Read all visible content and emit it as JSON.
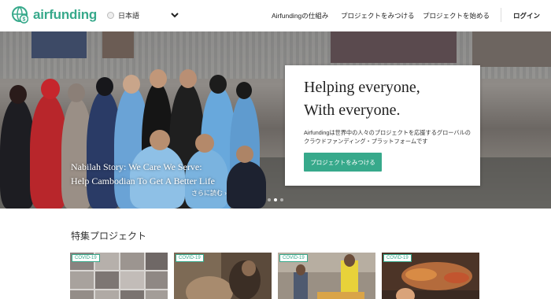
{
  "header": {
    "logo_text": "airfunding",
    "language": "日本語",
    "nav": [
      "Airfundingの仕組み",
      "プロジェクトをみつける",
      "プロジェクトを始める"
    ],
    "login": "ログイン"
  },
  "hero": {
    "caption_line1": "Nabilah Story: We Care We Serve:",
    "caption_line2": "Help Cambodian To Get A Better Life",
    "more_link": "さらに読む ›",
    "card": {
      "title_line1": "Helping everyone,",
      "title_line2": "With everyone.",
      "description": "Airfundingは世界中の人々のプロジェクトを応援するグローバルのクラウドファンディング・プラットフォームです",
      "button": "プロジェクトをみつける"
    }
  },
  "featured": {
    "title": "特集プロジェクト",
    "projects": [
      {
        "badge": "COVID-19"
      },
      {
        "badge": "COVID-19"
      },
      {
        "badge": "COVID-19"
      },
      {
        "badge": "COVID-19"
      }
    ]
  },
  "colors": {
    "brand": "#37a98b"
  }
}
